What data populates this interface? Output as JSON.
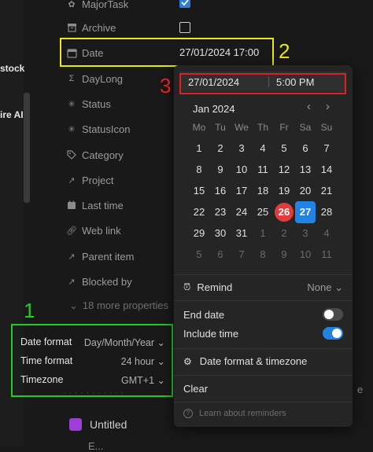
{
  "left_fragments": [
    "stock",
    "ire AI"
  ],
  "properties": [
    {
      "icon": "gear-icon",
      "label": "MajorTask"
    },
    {
      "icon": "archive-icon",
      "label": "Archive"
    },
    {
      "icon": "calendar-icon",
      "label": "Date",
      "value": "27/01/2024 17:00"
    },
    {
      "icon": "sigma-icon",
      "label": "DayLong"
    },
    {
      "icon": "loader-icon",
      "label": "Status"
    },
    {
      "icon": "loader-icon",
      "label": "StatusIcon"
    },
    {
      "icon": "tag-icon",
      "label": "Category"
    },
    {
      "icon": "arrow-up-right-icon",
      "label": "Project"
    },
    {
      "icon": "calendar-filled-icon",
      "label": "Last time"
    },
    {
      "icon": "link-icon",
      "label": "Web link"
    },
    {
      "icon": "arrow-up-right-icon",
      "label": "Parent item"
    },
    {
      "icon": "arrow-up-right-icon",
      "label": "Blocked by"
    }
  ],
  "more_properties": "18 more properties",
  "annotations": {
    "n1": "1",
    "n2": "2",
    "n3": "3"
  },
  "annotation_colors": {
    "green": "#22cc22",
    "yellow": "#e8e815",
    "red": "#e02020"
  },
  "format_box": [
    {
      "label": "Date format",
      "value": "Day/Month/Year"
    },
    {
      "label": "Time format",
      "value": "24 hour"
    },
    {
      "label": "Timezone",
      "value": "GMT+1"
    }
  ],
  "page": {
    "untitled": "Untitled",
    "bottom_fragment": "E...",
    "right_fragment": "e"
  },
  "picker": {
    "date_input": "27/01/2024",
    "time_input": "5:00 PM",
    "month_label": "Jan 2024",
    "weekdays": [
      "Mo",
      "Tu",
      "We",
      "Th",
      "Fr",
      "Sa",
      "Su"
    ],
    "weeks": [
      [
        "1",
        "2",
        "3",
        "4",
        "5",
        "6",
        "7"
      ],
      [
        "8",
        "9",
        "10",
        "11",
        "12",
        "13",
        "14"
      ],
      [
        "15",
        "16",
        "17",
        "18",
        "19",
        "20",
        "21"
      ],
      [
        "22",
        "23",
        "24",
        "25",
        "26",
        "27",
        "28"
      ],
      [
        "29",
        "30",
        "31",
        "1",
        "2",
        "3",
        "4"
      ],
      [
        "5",
        "6",
        "7",
        "8",
        "9",
        "10",
        "11"
      ]
    ],
    "today": "26",
    "selected": "27",
    "remind_label": "Remind",
    "remind_value": "None",
    "end_date_label": "End date",
    "end_date_on": false,
    "include_time_label": "Include time",
    "include_time_on": true,
    "format_tz_label": "Date format & timezone",
    "clear_label": "Clear",
    "learn_label": "Learn about reminders",
    "accent": "#2383e2",
    "today_color": "#e03e3e"
  }
}
